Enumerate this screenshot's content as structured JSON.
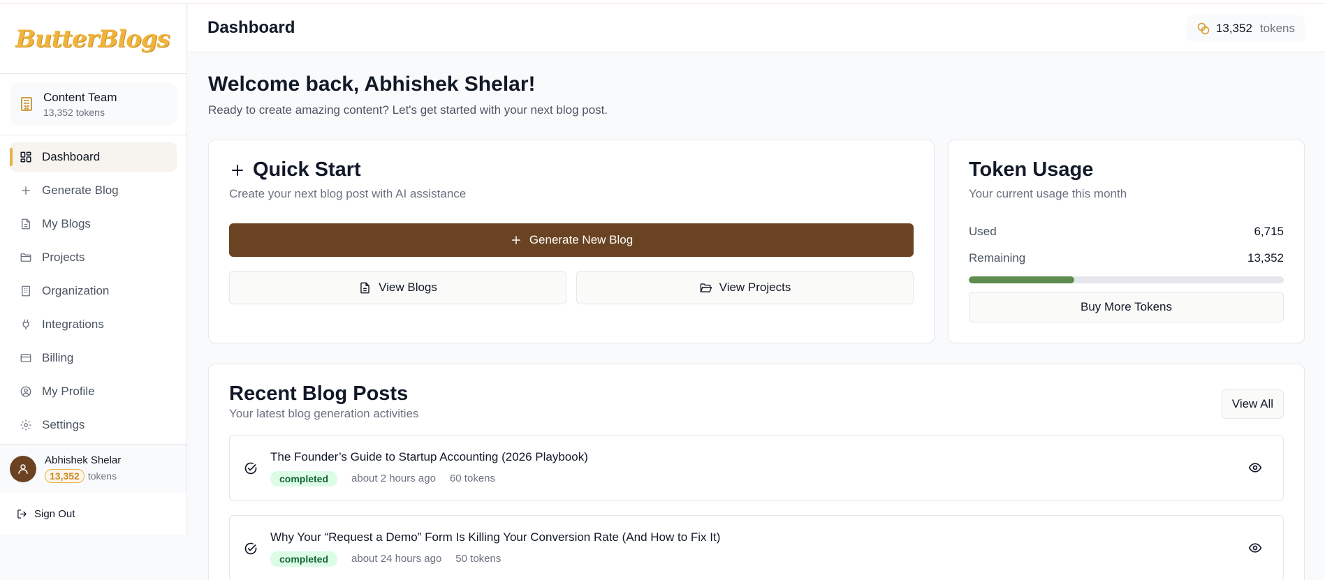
{
  "app": {
    "logo_text": "ButterBlogs"
  },
  "team": {
    "name": "Content Team",
    "tokens": "13,352 tokens"
  },
  "nav": [
    {
      "label": "Dashboard",
      "icon": "dashboard-icon",
      "active": true
    },
    {
      "label": "Generate Blog",
      "icon": "plus-icon"
    },
    {
      "label": "My Blogs",
      "icon": "document-icon"
    },
    {
      "label": "Projects",
      "icon": "folder-icon"
    },
    {
      "label": "Organization",
      "icon": "building-icon"
    },
    {
      "label": "Integrations",
      "icon": "plug-icon"
    },
    {
      "label": "Billing",
      "icon": "credit-card-icon"
    },
    {
      "label": "My Profile",
      "icon": "user-circle-icon"
    },
    {
      "label": "Settings",
      "icon": "gear-icon"
    }
  ],
  "user": {
    "name": "Abhishek Shelar",
    "tokens_value": "13,352",
    "tokens_unit": "tokens"
  },
  "signout_label": "Sign Out",
  "header": {
    "title": "Dashboard",
    "tokens_value": "13,352",
    "tokens_unit": "tokens"
  },
  "welcome": {
    "title": "Welcome back, Abhishek Shelar!",
    "subtitle": "Ready to create amazing content? Let's get started with your next blog post."
  },
  "quick_start": {
    "title": "Quick Start",
    "subtitle": "Create your next blog post with AI assistance",
    "primary_label": "Generate New Blog",
    "view_blogs_label": "View Blogs",
    "view_projects_label": "View Projects"
  },
  "token_usage": {
    "title": "Token Usage",
    "subtitle": "Your current usage this month",
    "used_label": "Used",
    "used_value": "6,715",
    "remaining_label": "Remaining",
    "remaining_value": "13,352",
    "progress_fraction": 0.335,
    "buy_label": "Buy More Tokens"
  },
  "recent": {
    "title": "Recent Blog Posts",
    "subtitle": "Your latest blog generation activities",
    "view_all_label": "View All",
    "posts": [
      {
        "title": "The Founder’s Guide to Startup Accounting (2026 Playbook)",
        "status": "completed",
        "time": "about 2 hours ago",
        "tokens": "60 tokens"
      },
      {
        "title": "Why Your “Request a Demo” Form Is Killing Your Conversion Rate (And How to Fix It)",
        "status": "completed",
        "time": "about 24 hours ago",
        "tokens": "50 tokens"
      }
    ]
  },
  "colors": {
    "brand": "#6a4322",
    "accent": "#e8b04a",
    "progress": "#5f8c4e",
    "success_bg": "#dcfce7",
    "success_text": "#166534"
  }
}
